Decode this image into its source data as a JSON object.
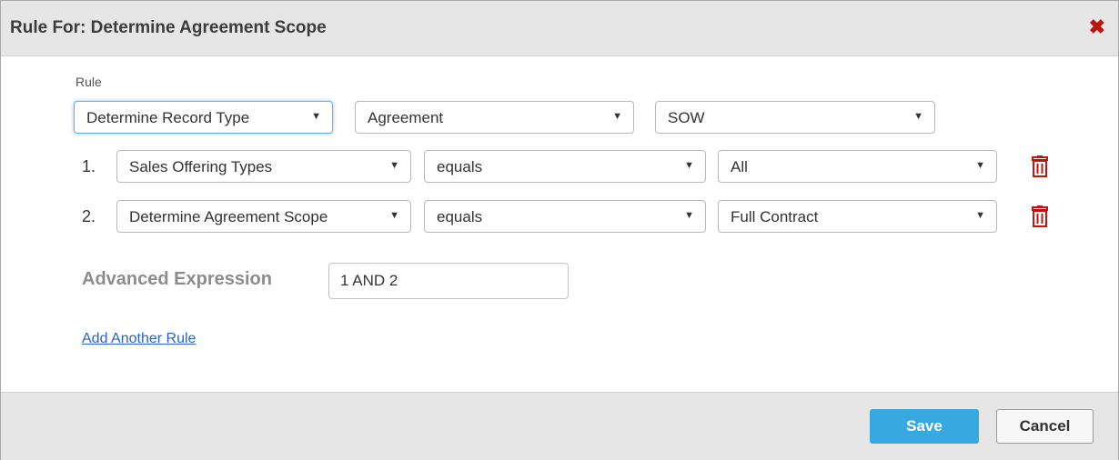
{
  "dialog": {
    "title": "Rule For: Determine Agreement Scope",
    "close_glyph": "✖"
  },
  "rule_label": "Rule",
  "rule_selects": [
    {
      "value": "Determine Record Type"
    },
    {
      "value": "Agreement"
    },
    {
      "value": "SOW"
    }
  ],
  "conditions": [
    {
      "number": "1.",
      "field": "Sales Offering Types",
      "operator": "equals",
      "value": "All"
    },
    {
      "number": "2.",
      "field": "Determine Agreement Scope",
      "operator": "equals",
      "value": "Full Contract"
    }
  ],
  "advanced_expression": {
    "label": "Advanced Expression",
    "value": "1 AND 2"
  },
  "add_rule_link": "Add Another Rule",
  "footer": {
    "save_label": "Save",
    "cancel_label": "Cancel"
  },
  "icons": {
    "close": "close-icon",
    "delete": "trash-icon",
    "dropdown": "caret-down-icon"
  },
  "colors": {
    "save_button": "#38a8e0",
    "close_icon": "#c0150e",
    "trash_icon": "#c0150e",
    "link": "#2a64c5"
  }
}
